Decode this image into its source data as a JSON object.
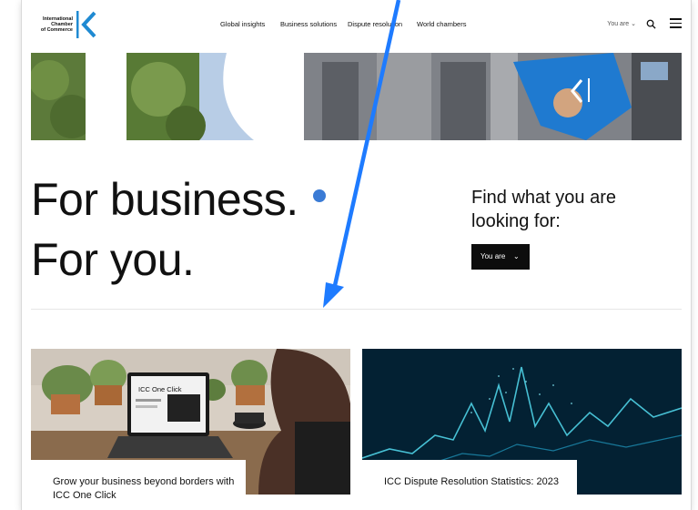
{
  "brand": {
    "logo_lines": [
      "International",
      "Chamber",
      "of Commerce"
    ]
  },
  "nav": {
    "items": [
      "Global insights",
      "Business solutions",
      "Dispute resolution",
      "World chambers"
    ],
    "you_are": "You are",
    "icons": [
      "search-icon",
      "hamburger-menu-icon"
    ]
  },
  "hero": {
    "headline_line1": "For business.",
    "headline_line2": "For you.",
    "find_line1": "Find what you are",
    "find_line2": "looking for:",
    "select_label": "You are"
  },
  "cards": [
    {
      "title": "Grow your business beyond borders with ICC One Click",
      "image_label": "ICC One Click"
    },
    {
      "title": "ICC Dispute Resolution Statistics: 2023"
    }
  ],
  "colors": {
    "accent": "#3a7bd5",
    "annotation_arrow": "#1e7bff",
    "button_bg": "#0d0d0d"
  }
}
